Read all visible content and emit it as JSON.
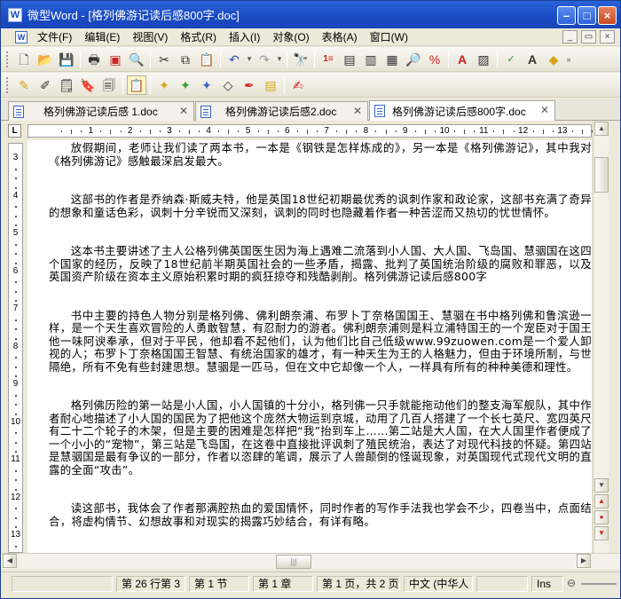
{
  "window": {
    "title": "微型Word - [格列佛游记读后感800字.doc]",
    "app_icon": "W"
  },
  "menu": [
    "文件(F)",
    "编辑(E)",
    "视图(V)",
    "格式(R)",
    "插入(I)",
    "对象(O)",
    "表格(A)",
    "窗口(W)"
  ],
  "toolbar1_icons": [
    "new-icon",
    "open-icon",
    "save-icon",
    "print-icon",
    "print-preview-icon",
    "export-pdf-icon",
    "cut-icon",
    "copy-icon",
    "paste-icon",
    "undo-icon",
    "redo-icon",
    "find-icon",
    "page-number-icon",
    "header-icon",
    "footer-icon",
    "page-setup-icon",
    "zoom-icon",
    "word-count-icon",
    "font-color-icon",
    "insert-picture-icon",
    "spell-check-icon",
    "font-icon",
    "format-icon"
  ],
  "toolbar2_icons": [
    "style-icon",
    "edit-icon",
    "note-icon",
    "bookmark-icon",
    "convert-icon",
    "paste-special-icon",
    "highlight-yellow-icon",
    "highlight-green-icon",
    "highlight-blue-icon",
    "eraser-icon",
    "pen-icon",
    "comment-icon",
    "track-icon"
  ],
  "tabs": [
    {
      "label": "格列佛游记读后感 1.doc",
      "active": false
    },
    {
      "label": "格列佛游记读后感2.doc",
      "active": false
    },
    {
      "label": "格列佛游记读后感800字.doc",
      "active": true
    }
  ],
  "ruler": {
    "tab_selector": "L",
    "numbers": [
      "1",
      "2",
      "3",
      "4",
      "5",
      "6",
      "7",
      "8",
      "9",
      "10",
      "11",
      "12",
      "13",
      "14"
    ]
  },
  "vruler_numbers": [
    "3",
    "4",
    "5",
    "6",
    "7",
    "8",
    "9",
    "10",
    "11",
    "12",
    "13"
  ],
  "document": {
    "paragraphs": [
      "放假期间，老师让我们读了两本书，一本是《钢铁是怎样炼成的》，另一本是《格列佛游记》，其中我对《格列佛游记》感触最深启发最大。",
      "",
      "这部书的作者是乔纳森·斯威夫特，他是英国18世纪初期最优秀的讽刺作家和政论家，这部书充满了奇异的想象和童话色彩，讽刺十分辛锐而又深刻，讽刺的同时也隐藏着作者一种苦涩而又热切的忧世情怀。",
      "",
      "这本书主要讲述了主人公格列佛英国医生因为海上遇难二流落到小人国、大人国、飞岛国、慧骃国在这四个国家的经历，反映了18世纪前半期英国社会的一些矛盾，揭露、批判了英国统治阶级的腐败和罪恶，以及英国资产阶级在资本主义原始积累时期的疯狂掠夺和残酷剥削。格列佛游记读后感800字",
      "",
      "书中主要的持色人物分别是格列佛、佛利朗奈浦、布罗卜丁奈格国国王、慧骃在书中格列佛和鲁滨逊一样，是一个天生喜欢冒险的人勇敢智慧，有忍耐力的游者。佛利朗奈浦则是料立浦特国王的一个宠臣对于国王他一味阿谀奉承，但对于平民，他却看不起他们，认为他们比自己低级www.99zuowen.com是一个爱人卸视的人；布罗卜丁奈格国国王智慧、有统治国家的雄才，有一种天生为王的人格魅力，但由于环境所制，与世隔绝，所有不免有些封建思想。慧骃是一匹马，但在文中它却像一个人，一样具有所有的种种美德和理性。",
      "",
      "格列佛历险的第一站是小人国，小人国镇的十分小，格列佛一只手就能拖动他们的整支海军舰队，其中作者耐心地描述了小人国的国民为了把他这个庞然大物运到京城，动用了几百人搭建了一个长七英尺、宽四英尺有二十二个轮子的木架，但是主要的困难是怎样把“我”抬到车上……第二站是大人国，在大人国里作者便成了一个小小的“宠物”，第三站是飞岛国，在这卷中直接批评讽刺了殖民统治，表达了对现代科技的怀疑。第四站是慧骃国是最有争议的一部分，作者以恣肆的笔调，展示了人兽颠倒的怪诞现象，对英国现代式现代文明的直露的全面“攻击”。",
      "",
      "读这部书，我体会了作者那满腔热血的爱国情怀，同时作者的写作手法我也学会不少，四卷当中，点面结合，将虚构情节、幻想故事和对现实的揭露巧妙结合，有详有略。"
    ]
  },
  "status": {
    "line_col": "第 26 行第 3",
    "section": "第 1 节",
    "chapter": "第 1 章",
    "page": "第 1 页，共 2 页",
    "language": "中文 (中华人",
    "mode": "Ins"
  }
}
